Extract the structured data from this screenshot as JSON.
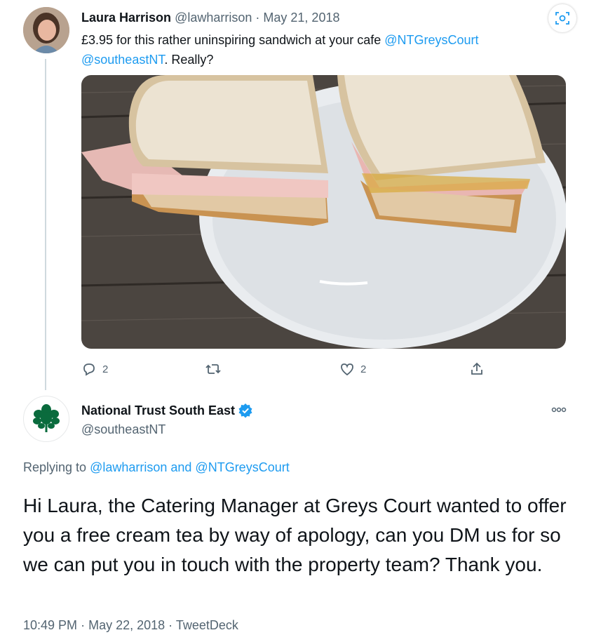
{
  "tweet1": {
    "author_name": "Laura Harrison",
    "author_handle": "@lawharrison",
    "separator": "·",
    "date": "May 21, 2018",
    "text_plain": "£3.95 for this rather uninspiring sandwich at your cafe ",
    "mention1": "@NTGreysCourt",
    "mention2": "@southeastNT",
    "text_tail": ". Really?",
    "replies": "2",
    "likes": "2"
  },
  "tweet2": {
    "author_name": "National Trust South East",
    "author_handle": "@southeastNT",
    "replying_prefix": "Replying to ",
    "replying_user1": "@lawharrison",
    "replying_and": " and ",
    "replying_user2": "@NTGreysCourt",
    "text": "Hi Laura, the Catering Manager at Greys Court wanted to offer you a free cream tea by way of apology, can you DM us for so we can put you in touch with the property team? Thank you.",
    "time": "10:49 PM",
    "separator": "·",
    "date": "May 22, 2018",
    "source": "TweetDeck"
  },
  "colors": {
    "link": "#1d9bf0",
    "muted": "#536471",
    "text": "#0f1419",
    "verified": "#1d9bf0"
  },
  "icons": [
    "reply-icon",
    "retweet-icon",
    "like-icon",
    "share-icon",
    "more-icon",
    "verified-icon",
    "media-icon"
  ]
}
